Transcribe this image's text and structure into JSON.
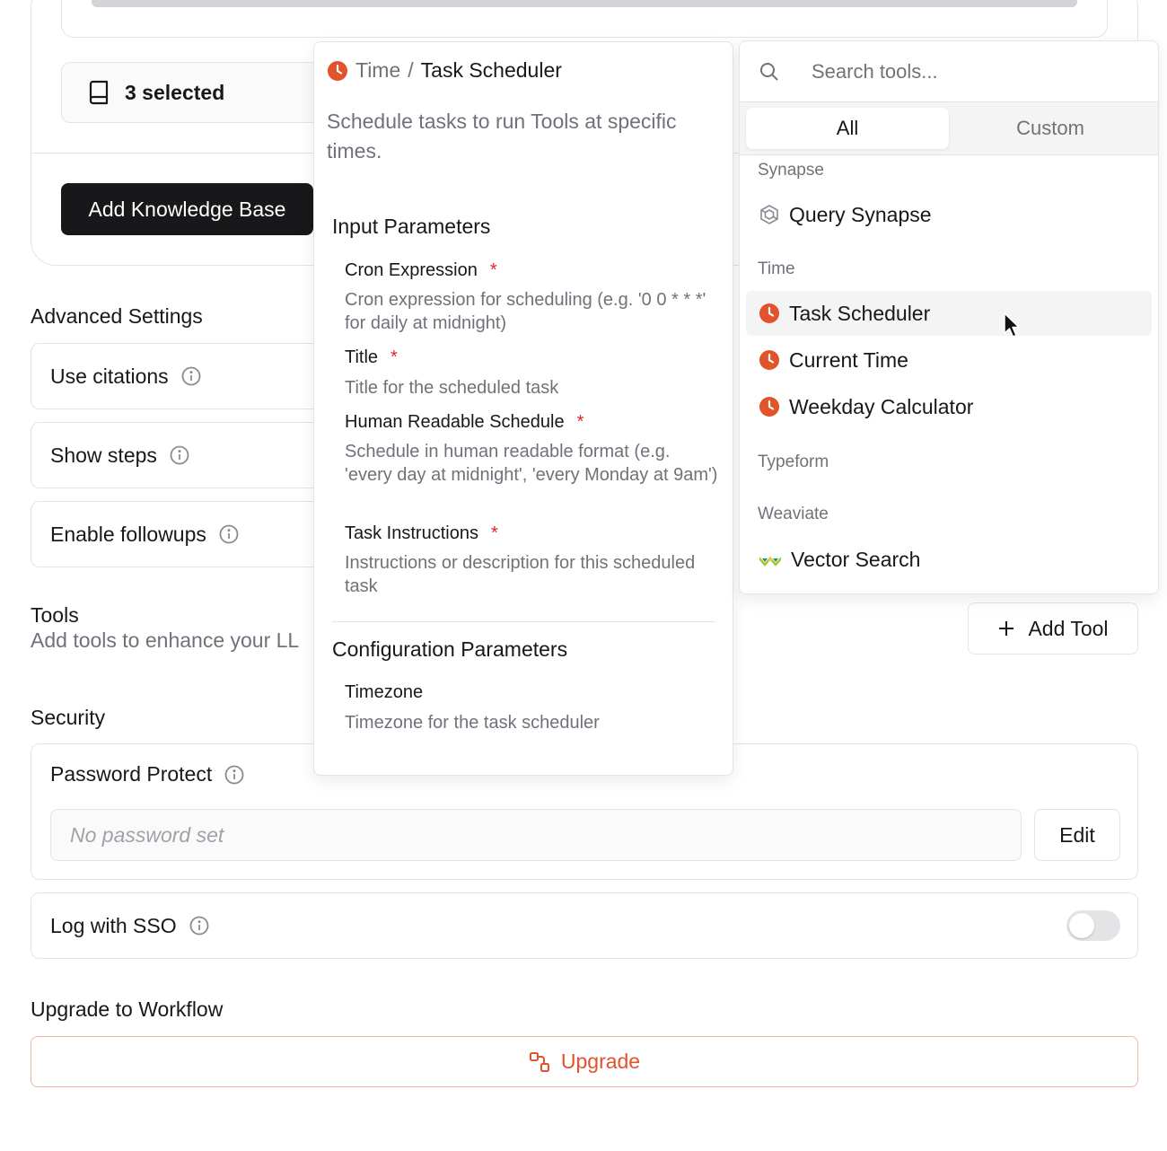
{
  "knowledge_base": {
    "selected_label": "3 selected",
    "add_button": "Add Knowledge Base"
  },
  "advanced_settings": {
    "title": "Advanced Settings",
    "items": [
      {
        "label": "Use citations"
      },
      {
        "label": "Show steps"
      },
      {
        "label": "Enable followups"
      }
    ]
  },
  "tools_section": {
    "title": "Tools",
    "subtitle": "Add tools to enhance your LL",
    "add_button": "Add Tool"
  },
  "tool_detail": {
    "breadcrumb_category": "Time",
    "breadcrumb_separator": "/",
    "breadcrumb_name": "Task Scheduler",
    "description": "Schedule tasks to run Tools at specific times.",
    "input_heading": "Input Parameters",
    "inputs": [
      {
        "name": "Cron Expression",
        "required": "*",
        "desc": "Cron expression for scheduling (e.g. '0 0 * * *' for daily at midnight)"
      },
      {
        "name": "Title",
        "required": "*",
        "desc": "Title for the scheduled task"
      },
      {
        "name": "Human Readable Schedule",
        "required": "*",
        "desc": "Schedule in human readable format (e.g. 'every day at midnight', 'every Monday at 9am')"
      },
      {
        "name": "Task Instructions",
        "required": "*",
        "desc": "Instructions or description for this scheduled task"
      }
    ],
    "config_heading": "Configuration Parameters",
    "config": [
      {
        "name": "Timezone",
        "desc": "Timezone for the task scheduler"
      }
    ]
  },
  "tool_picker": {
    "search_placeholder": "Search tools...",
    "tabs": {
      "all": "All",
      "custom": "Custom"
    },
    "groups": {
      "synapse": {
        "title": "Synapse",
        "items": [
          "Query Synapse"
        ]
      },
      "time": {
        "title": "Time",
        "items": [
          "Task Scheduler",
          "Current Time",
          "Weekday Calculator"
        ]
      },
      "typeform": {
        "title": "Typeform"
      },
      "weaviate": {
        "title": "Weaviate",
        "items": [
          "Vector Search"
        ]
      }
    },
    "colors": {
      "clock": "#e0532b",
      "hover_bg": "#f4f4f5"
    }
  },
  "security": {
    "title": "Security",
    "password_label": "Password Protect",
    "password_placeholder": "No password set",
    "edit_button": "Edit",
    "sso_label": "Log with SSO",
    "sso_enabled": false
  },
  "workflow": {
    "title": "Upgrade to Workflow",
    "upgrade_button": "Upgrade",
    "accent": "#e0532b"
  }
}
